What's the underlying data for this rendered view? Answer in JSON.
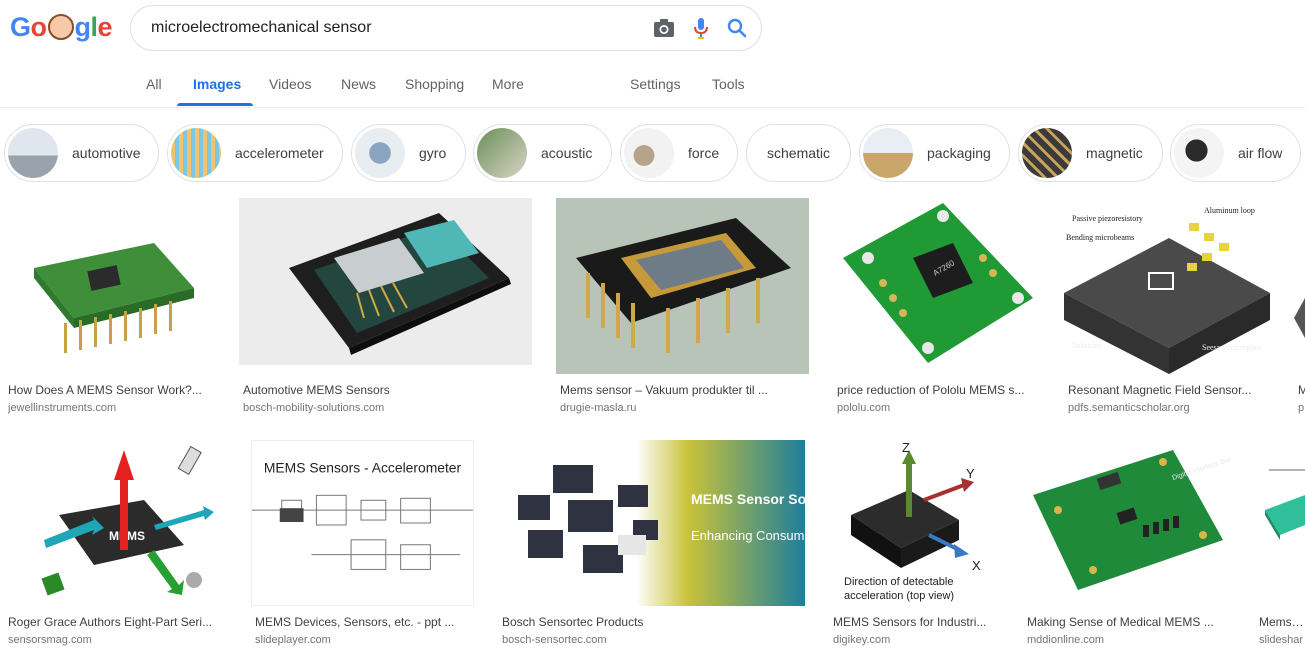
{
  "logo": {
    "letters": [
      "G",
      "o",
      "o",
      "g",
      "l",
      "e"
    ],
    "colors": [
      "#4285f4",
      "#ea4335",
      "#fbbc05",
      "#4285f4",
      "#34a853",
      "#ea4335"
    ]
  },
  "search": {
    "query": "microelectromechanical sensor",
    "icons": [
      "camera-icon",
      "microphone-icon",
      "search-icon"
    ]
  },
  "tabs": [
    {
      "label": "All"
    },
    {
      "label": "Images"
    },
    {
      "label": "Videos"
    },
    {
      "label": "News"
    },
    {
      "label": "Shopping"
    },
    {
      "label": "More"
    },
    {
      "label": "Settings"
    },
    {
      "label": "Tools"
    }
  ],
  "active_tab": "Images",
  "accent_color": "#1a73e8",
  "chips": [
    {
      "label": "automotive"
    },
    {
      "label": "accelerometer"
    },
    {
      "label": "gyro"
    },
    {
      "label": "acoustic"
    },
    {
      "label": "force"
    },
    {
      "label": "schematic"
    },
    {
      "label": "packaging"
    },
    {
      "label": "magnetic"
    },
    {
      "label": "air flow"
    }
  ],
  "results": [
    {
      "caption": "How Does A MEMS Sensor Work?...",
      "site": "jewellinstruments.com"
    },
    {
      "caption": "Automotive MEMS Sensors",
      "site": "bosch-mobility-solutions.com"
    },
    {
      "caption": "Mems sensor – Vakuum produkter til ...",
      "site": "drugie-masla.ru"
    },
    {
      "caption": "price reduction of Pololu MEMS s...",
      "site": "pololu.com"
    },
    {
      "caption": "Resonant Magnetic Field Sensor...",
      "site": "pdfs.semanticscholar.org"
    },
    {
      "caption": "M",
      "site": "p"
    },
    {
      "caption": "Roger Grace Authors Eight-Part Seri...",
      "site": "sensorsmag.com"
    },
    {
      "caption": "MEMS Devices, Sensors, etc. - ppt ...",
      "site": "slideplayer.com"
    },
    {
      "caption": "Bosch Sensortec Products",
      "site": "bosch-sensortec.com"
    },
    {
      "caption": "MEMS Sensors for Industri...",
      "site": "digikey.com"
    },
    {
      "caption": "Making Sense of Medical MEMS ...",
      "site": "mddionline.com"
    },
    {
      "caption": "Mems se",
      "site": "slideshar"
    }
  ],
  "image_text": {
    "magnetic_labels": [
      "Passive piezoresistory",
      "Aluminum loop",
      "Bending microbeams",
      "Substrate",
      "Seesaw microplate"
    ],
    "mems_chip_label": "MEMS",
    "ppt_title": "MEMS Sensors - Accelerometer",
    "bosch_title": "MEMS Sensor Solutions",
    "bosch_subtitle": "Enhancing Consumer Experience",
    "axis_labels": [
      "Z",
      "Y",
      "X"
    ],
    "accel_caption": "Direction of detectable acceleration (top view)",
    "board_label": "Digital Interface Board",
    "chip_marking": "A7260"
  }
}
